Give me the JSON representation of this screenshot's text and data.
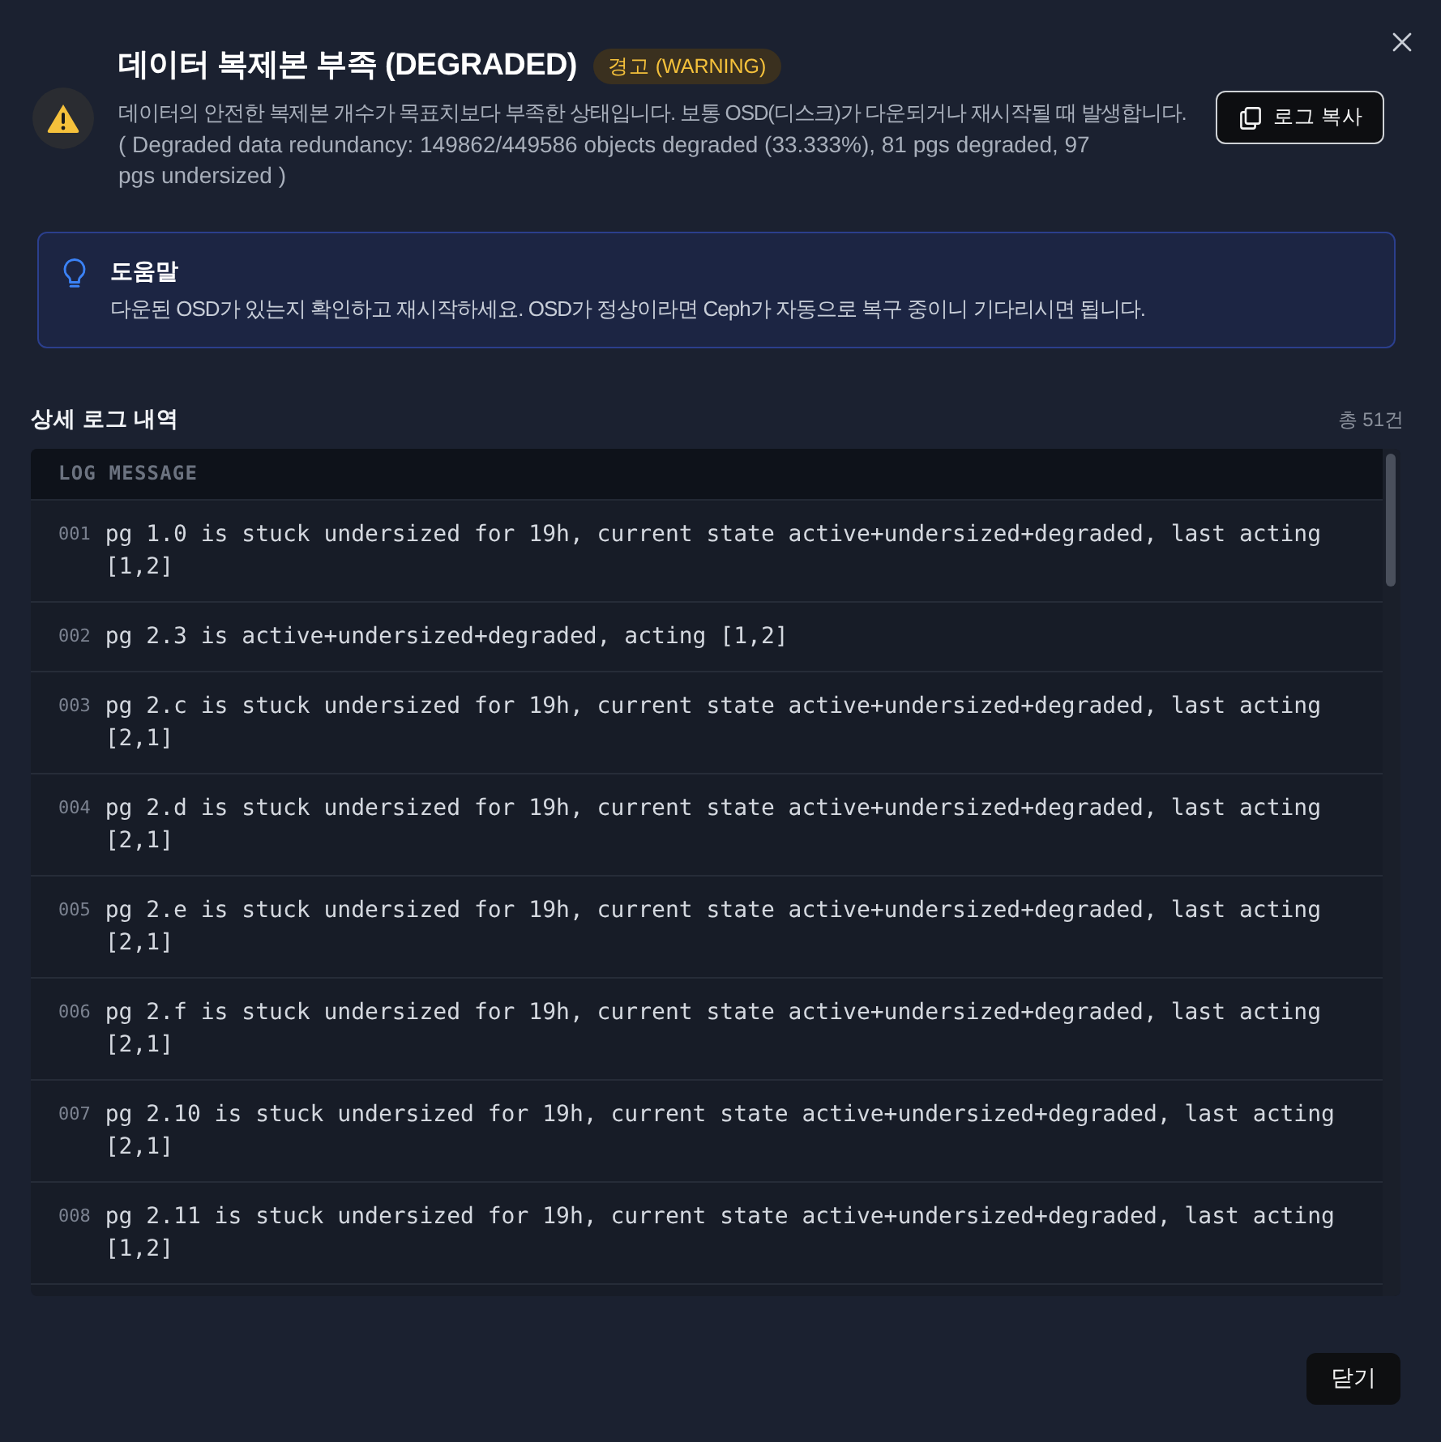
{
  "dialog": {
    "title": "데이터 복제본 부족 (DEGRADED)",
    "badge": "경고 (WARNING)",
    "description": "데이터의 안전한 복제본 개수가 목표치보다 부족한 상태입니다. 보통 OSD(디스크)가 다운되거나 재시작될 때 발생합니다.",
    "detail": "( Degraded data redundancy: 149862/449586 objects degraded (33.333%), 81 pgs degraded, 97 pgs undersized )",
    "copy_button": "로그 복사"
  },
  "help": {
    "title": "도움말",
    "text": "다운된 OSD가 있는지 확인하고 재시작하세요. OSD가 정상이라면 Ceph가 자동으로 복구 중이니 기다리시면 됩니다."
  },
  "log_section": {
    "title": "상세 로그 내역",
    "count": "총 51건",
    "column": "LOG MESSAGE",
    "rows": [
      {
        "number": "001",
        "message": "pg 1.0 is stuck undersized for 19h, current state active+undersized+degraded, last acting [1,2]"
      },
      {
        "number": "002",
        "message": "pg 2.3 is active+undersized+degraded, acting [1,2]"
      },
      {
        "number": "003",
        "message": "pg 2.c is stuck undersized for 19h, current state active+undersized+degraded, last acting [2,1]"
      },
      {
        "number": "004",
        "message": "pg 2.d is stuck undersized for 19h, current state active+undersized+degraded, last acting [2,1]"
      },
      {
        "number": "005",
        "message": "pg 2.e is stuck undersized for 19h, current state active+undersized+degraded, last acting [2,1]"
      },
      {
        "number": "006",
        "message": "pg 2.f is stuck undersized for 19h, current state active+undersized+degraded, last acting [2,1]"
      },
      {
        "number": "007",
        "message": "pg 2.10 is stuck undersized for 19h, current state active+undersized+degraded, last acting [2,1]"
      },
      {
        "number": "008",
        "message": "pg 2.11 is stuck undersized for 19h, current state active+undersized+degraded, last acting [1,2]"
      }
    ]
  },
  "footer": {
    "close_button": "닫기"
  }
}
